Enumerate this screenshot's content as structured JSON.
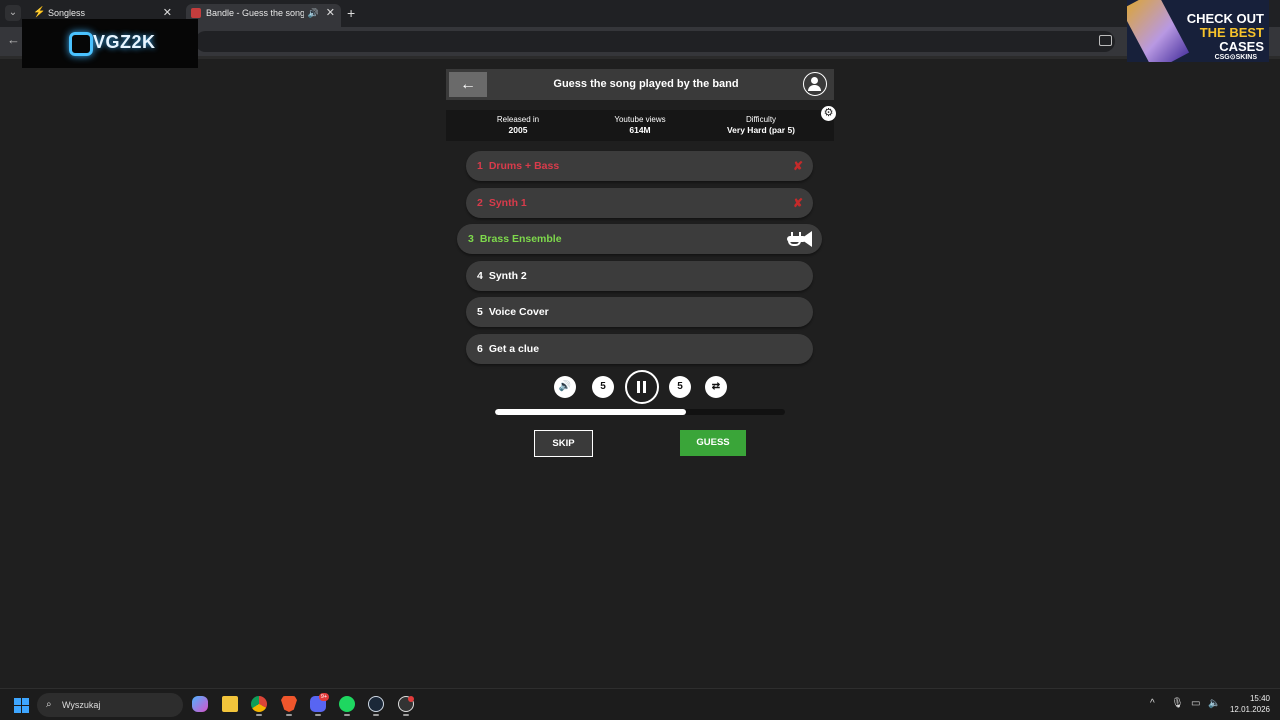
{
  "browser": {
    "tabs": [
      {
        "title": "Songless",
        "close": "✕"
      },
      {
        "title": "Bandle - Guess the song, o",
        "close": "✕"
      }
    ],
    "new_tab": "+",
    "tab_menu": "⌄",
    "back": "←"
  },
  "overlays": {
    "stream_logo": "VGZ2K",
    "promo": {
      "line1": "CHECK OUT",
      "line2": "THE BEST",
      "line3": "CASES",
      "brand": "CSG⊙SKINS"
    }
  },
  "game": {
    "header": {
      "back": "←",
      "title": "Guess the song played by the band"
    },
    "info": [
      {
        "label": "Released in",
        "value": "2005"
      },
      {
        "label": "Youtube views",
        "value": "614M"
      },
      {
        "label": "Difficulty",
        "value": "Very Hard (par 5)"
      }
    ],
    "settings": "⚙",
    "rows": [
      {
        "num": "1",
        "label": "Drums + Bass",
        "state": "failed",
        "mark": "✘"
      },
      {
        "num": "2",
        "label": "Synth 1",
        "state": "failed",
        "mark": "✘"
      },
      {
        "num": "3",
        "label": "Brass Ensemble",
        "state": "active",
        "mark": ""
      },
      {
        "num": "4",
        "label": "Synth 2",
        "state": "pending",
        "mark": ""
      },
      {
        "num": "5",
        "label": "Voice Cover",
        "state": "pending",
        "mark": ""
      },
      {
        "num": "6",
        "label": "Get a clue",
        "state": "pending",
        "mark": ""
      }
    ],
    "controls": {
      "volume": "🔊",
      "rewind": "5",
      "forward": "5",
      "repeat": "⇄"
    },
    "progress_fraction": 0.66,
    "skip_label": "SKIP",
    "guess_label": "GUESS",
    "colors": {
      "failed": "#d93b4b",
      "active": "#7ed94c",
      "guess": "#3aa539"
    }
  },
  "taskbar": {
    "search_placeholder": "Wyszukaj",
    "discord_badge": "9+",
    "time": "15:40",
    "date": "12.01.2026"
  }
}
